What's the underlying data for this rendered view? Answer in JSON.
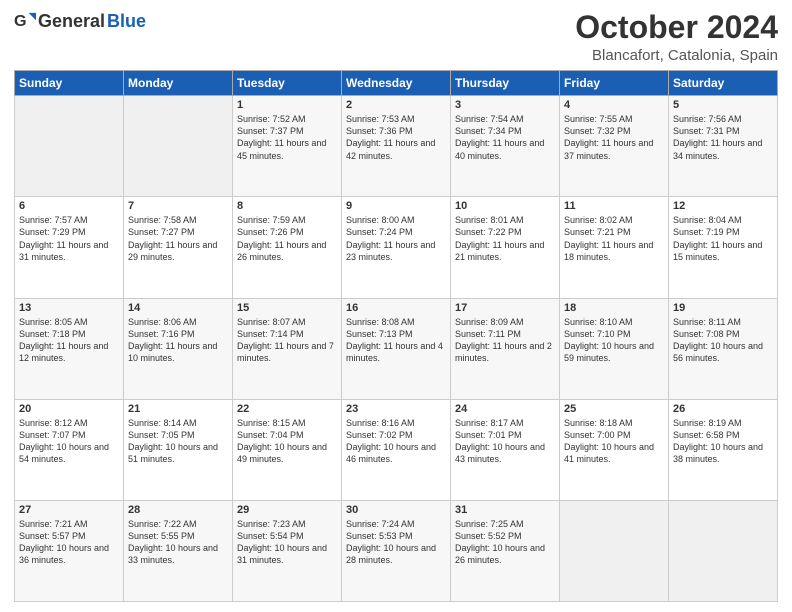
{
  "header": {
    "logo_general": "General",
    "logo_blue": "Blue",
    "month": "October 2024",
    "location": "Blancafort, Catalonia, Spain"
  },
  "days_of_week": [
    "Sunday",
    "Monday",
    "Tuesday",
    "Wednesday",
    "Thursday",
    "Friday",
    "Saturday"
  ],
  "weeks": [
    [
      {
        "day": "",
        "info": ""
      },
      {
        "day": "",
        "info": ""
      },
      {
        "day": "1",
        "info": "Sunrise: 7:52 AM\nSunset: 7:37 PM\nDaylight: 11 hours and 45 minutes."
      },
      {
        "day": "2",
        "info": "Sunrise: 7:53 AM\nSunset: 7:36 PM\nDaylight: 11 hours and 42 minutes."
      },
      {
        "day": "3",
        "info": "Sunrise: 7:54 AM\nSunset: 7:34 PM\nDaylight: 11 hours and 40 minutes."
      },
      {
        "day": "4",
        "info": "Sunrise: 7:55 AM\nSunset: 7:32 PM\nDaylight: 11 hours and 37 minutes."
      },
      {
        "day": "5",
        "info": "Sunrise: 7:56 AM\nSunset: 7:31 PM\nDaylight: 11 hours and 34 minutes."
      }
    ],
    [
      {
        "day": "6",
        "info": "Sunrise: 7:57 AM\nSunset: 7:29 PM\nDaylight: 11 hours and 31 minutes."
      },
      {
        "day": "7",
        "info": "Sunrise: 7:58 AM\nSunset: 7:27 PM\nDaylight: 11 hours and 29 minutes."
      },
      {
        "day": "8",
        "info": "Sunrise: 7:59 AM\nSunset: 7:26 PM\nDaylight: 11 hours and 26 minutes."
      },
      {
        "day": "9",
        "info": "Sunrise: 8:00 AM\nSunset: 7:24 PM\nDaylight: 11 hours and 23 minutes."
      },
      {
        "day": "10",
        "info": "Sunrise: 8:01 AM\nSunset: 7:22 PM\nDaylight: 11 hours and 21 minutes."
      },
      {
        "day": "11",
        "info": "Sunrise: 8:02 AM\nSunset: 7:21 PM\nDaylight: 11 hours and 18 minutes."
      },
      {
        "day": "12",
        "info": "Sunrise: 8:04 AM\nSunset: 7:19 PM\nDaylight: 11 hours and 15 minutes."
      }
    ],
    [
      {
        "day": "13",
        "info": "Sunrise: 8:05 AM\nSunset: 7:18 PM\nDaylight: 11 hours and 12 minutes."
      },
      {
        "day": "14",
        "info": "Sunrise: 8:06 AM\nSunset: 7:16 PM\nDaylight: 11 hours and 10 minutes."
      },
      {
        "day": "15",
        "info": "Sunrise: 8:07 AM\nSunset: 7:14 PM\nDaylight: 11 hours and 7 minutes."
      },
      {
        "day": "16",
        "info": "Sunrise: 8:08 AM\nSunset: 7:13 PM\nDaylight: 11 hours and 4 minutes."
      },
      {
        "day": "17",
        "info": "Sunrise: 8:09 AM\nSunset: 7:11 PM\nDaylight: 11 hours and 2 minutes."
      },
      {
        "day": "18",
        "info": "Sunrise: 8:10 AM\nSunset: 7:10 PM\nDaylight: 10 hours and 59 minutes."
      },
      {
        "day": "19",
        "info": "Sunrise: 8:11 AM\nSunset: 7:08 PM\nDaylight: 10 hours and 56 minutes."
      }
    ],
    [
      {
        "day": "20",
        "info": "Sunrise: 8:12 AM\nSunset: 7:07 PM\nDaylight: 10 hours and 54 minutes."
      },
      {
        "day": "21",
        "info": "Sunrise: 8:14 AM\nSunset: 7:05 PM\nDaylight: 10 hours and 51 minutes."
      },
      {
        "day": "22",
        "info": "Sunrise: 8:15 AM\nSunset: 7:04 PM\nDaylight: 10 hours and 49 minutes."
      },
      {
        "day": "23",
        "info": "Sunrise: 8:16 AM\nSunset: 7:02 PM\nDaylight: 10 hours and 46 minutes."
      },
      {
        "day": "24",
        "info": "Sunrise: 8:17 AM\nSunset: 7:01 PM\nDaylight: 10 hours and 43 minutes."
      },
      {
        "day": "25",
        "info": "Sunrise: 8:18 AM\nSunset: 7:00 PM\nDaylight: 10 hours and 41 minutes."
      },
      {
        "day": "26",
        "info": "Sunrise: 8:19 AM\nSunset: 6:58 PM\nDaylight: 10 hours and 38 minutes."
      }
    ],
    [
      {
        "day": "27",
        "info": "Sunrise: 7:21 AM\nSunset: 5:57 PM\nDaylight: 10 hours and 36 minutes."
      },
      {
        "day": "28",
        "info": "Sunrise: 7:22 AM\nSunset: 5:55 PM\nDaylight: 10 hours and 33 minutes."
      },
      {
        "day": "29",
        "info": "Sunrise: 7:23 AM\nSunset: 5:54 PM\nDaylight: 10 hours and 31 minutes."
      },
      {
        "day": "30",
        "info": "Sunrise: 7:24 AM\nSunset: 5:53 PM\nDaylight: 10 hours and 28 minutes."
      },
      {
        "day": "31",
        "info": "Sunrise: 7:25 AM\nSunset: 5:52 PM\nDaylight: 10 hours and 26 minutes."
      },
      {
        "day": "",
        "info": ""
      },
      {
        "day": "",
        "info": ""
      }
    ]
  ]
}
